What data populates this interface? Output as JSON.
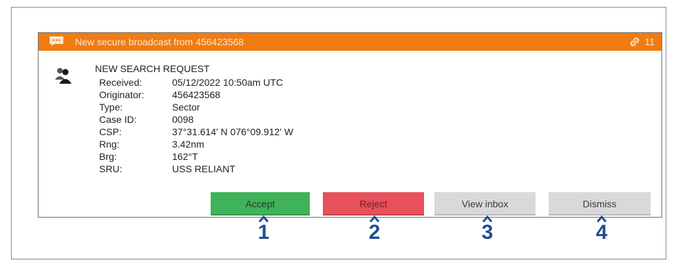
{
  "header": {
    "title": "New secure broadcast from 456423568",
    "count": "11",
    "color": "#f07c12",
    "icons": [
      "message-icon",
      "link-icon"
    ]
  },
  "request": {
    "title": "NEW SEARCH REQUEST",
    "icon": "person-icon",
    "fields": [
      {
        "label": "Received:",
        "value": "05/12/2022 10:50am UTC"
      },
      {
        "label": "Originator:",
        "value": "456423568"
      },
      {
        "label": "Type:",
        "value": "Sector"
      },
      {
        "label": "Case ID:",
        "value": "0098"
      },
      {
        "label": "CSP:",
        "value": "37°31.614' N 076°09.912' W"
      },
      {
        "label": "Rng:",
        "value": "3.42nm"
      },
      {
        "label": "Brg:",
        "value": "162°T"
      },
      {
        "label": "SRU:",
        "value": "USS RELIANT"
      }
    ]
  },
  "buttons": {
    "accept": "Accept",
    "reject": "Reject",
    "view_inbox": "View inbox",
    "dismiss": "Dismiss"
  },
  "callouts": [
    "1",
    "2",
    "3",
    "4"
  ],
  "colors": {
    "accept": "#3fb25a",
    "reject": "#e8505a",
    "neutral": "#d9d9d9",
    "callout": "#1f4d8e"
  }
}
